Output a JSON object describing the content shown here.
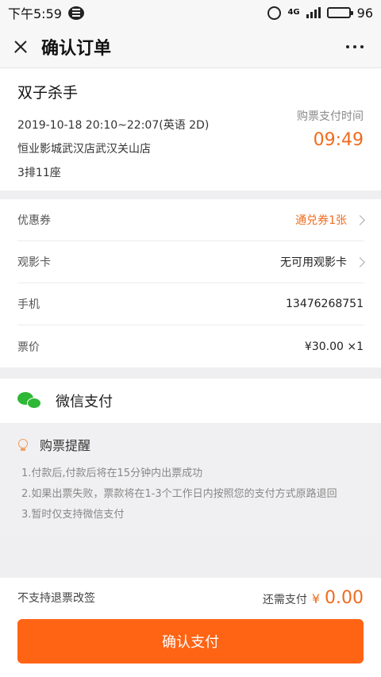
{
  "status_bar": {
    "time": "下午5:59",
    "network": "4G",
    "battery_level": "96"
  },
  "nav": {
    "title": "确认订单"
  },
  "order": {
    "movie_title": "双子杀手",
    "session": "2019-10-18 20:10~22:07(英语 2D)",
    "cinema": "恒业影城武汉店武汉关山店",
    "seat": "3排11座",
    "timer_label": "购票支付时间",
    "timer": "09:49"
  },
  "info_rows": [
    {
      "label": "优惠券",
      "value": "通兑券1张"
    },
    {
      "label": "观影卡",
      "value": "无可用观影卡"
    },
    {
      "label": "手机",
      "value": "13476268751"
    },
    {
      "label": "票价",
      "value": "¥30.00 ×1"
    }
  ],
  "payment": {
    "method": "微信支付"
  },
  "notice": {
    "title": "购票提醒",
    "items": [
      "1.付款后,付款后将在15分钟内出票成功",
      "2.如果出票失败，票款将在1-3个工作日内按照您的支付方式原路退回",
      "3.暂时仅支持微信支付"
    ]
  },
  "footer": {
    "refund_note": "不支持退票改签",
    "due_label": "还需支付",
    "currency": "¥",
    "amount": "0.00",
    "confirm_label": "确认支付"
  },
  "colors": {
    "accent": "#ff6415",
    "accent_text": "#f06b1e",
    "wechat_green": "#2fb836"
  }
}
